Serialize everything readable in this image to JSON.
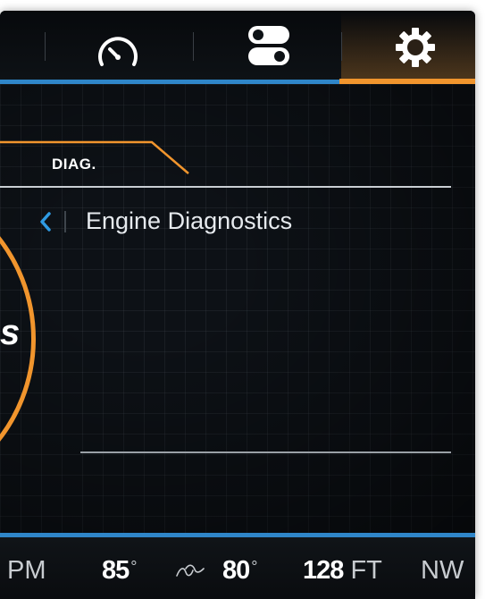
{
  "colors": {
    "accent_blue": "#2f86c9",
    "accent_orange": "#f1952d",
    "background": "#0d1116",
    "text": "#e6eaee"
  },
  "top_nav": {
    "tabs": [
      {
        "name": "gauges",
        "icon": "speedometer-icon",
        "active": false
      },
      {
        "name": "controls",
        "icon": "toggle-switches-icon",
        "active": false
      },
      {
        "name": "settings",
        "icon": "gear-icon",
        "active": true
      }
    ]
  },
  "gauge": {
    "fragment_text": "s"
  },
  "diag": {
    "tab_label": "DIAG.",
    "title": "Engine Diagnostics",
    "back_icon": "chevron-left-icon"
  },
  "status_bar": {
    "time_suffix": "PM",
    "temperature": "85",
    "water_temp": "80",
    "depth_value": "128",
    "depth_unit": "FT",
    "heading": "NW",
    "degree_symbol": "°",
    "wind_icon": "wind-icon"
  }
}
